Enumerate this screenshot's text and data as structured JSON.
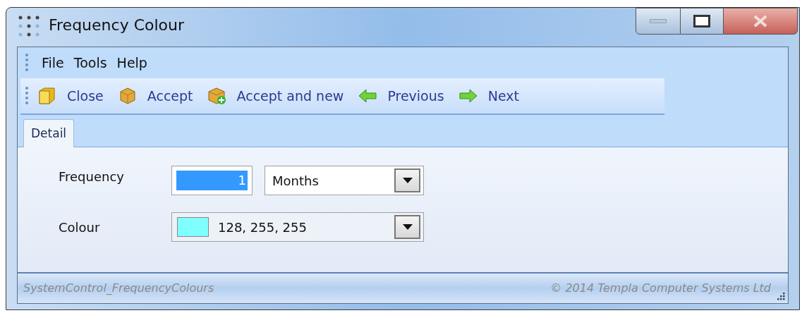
{
  "window": {
    "title": "Frequency Colour"
  },
  "menu": [
    "File",
    "Tools",
    "Help"
  ],
  "toolbar": [
    "Close",
    "Accept",
    "Accept and new",
    "Previous",
    "Next"
  ],
  "tabs": [
    {
      "label": "Detail",
      "selected": true
    }
  ],
  "form": {
    "frequency": {
      "label": "Frequency",
      "value": "1",
      "value_selected": true,
      "unit": "Months"
    },
    "colour": {
      "label": "Colour",
      "value": "128, 255, 255",
      "color": "#80ffff"
    }
  },
  "status_bar": {
    "left": "SystemControl_FrequencyColours",
    "right": "© 2014 Templa Computer Systems Ltd"
  }
}
